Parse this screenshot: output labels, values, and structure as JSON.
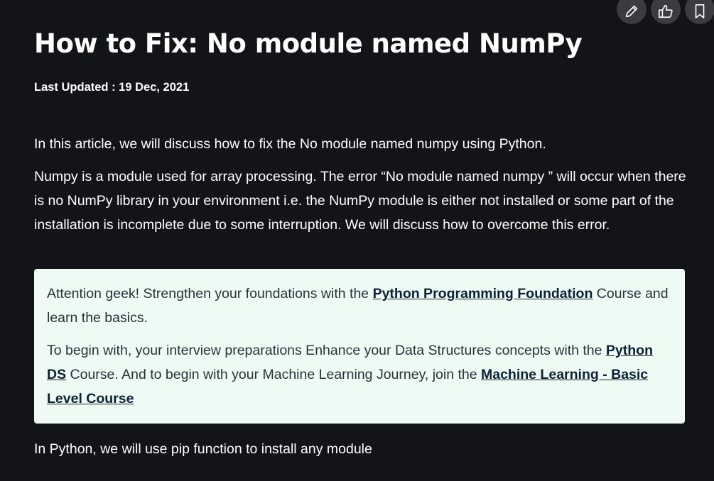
{
  "actions": {
    "edit": "pencil-icon",
    "like": "thumbs-up-icon",
    "bookmark": "bookmark-icon"
  },
  "article": {
    "title": "How to Fix: No module named NumPy",
    "last_updated": "Last Updated : 19 Dec, 2021",
    "intro": "In this article, we will discuss how to fix the No module named numpy using Python.",
    "description": "Numpy is a module used for array processing. The error “No module named numpy ” will occur when there is no NumPy library in your environment i.e. the NumPy module is either not installed or some part of the installation is incomplete due to some interruption. We will discuss how to overcome this error.",
    "pip_note": "In Python, we will use pip function to install any module"
  },
  "callout": {
    "line1_prefix": " Attention geek! Strengthen your foundations with the ",
    "line1_link": "Python Programming Foundation",
    "line1_suffix": " Course and learn the basics.",
    "line2_prefix": "To begin with, your interview preparations Enhance your Data Structures concepts with the ",
    "line2_link1": "Python DS",
    "line2_middle": " Course. And to begin with your Machine Learning Journey, join the ",
    "line2_link2": "Machine Learning - Basic Level Course"
  },
  "colors": {
    "background": "#131417",
    "callout_background": "#eefbf5",
    "callout_text": "#273239",
    "link": "#0b2236",
    "action_button": "#3a3c40"
  }
}
